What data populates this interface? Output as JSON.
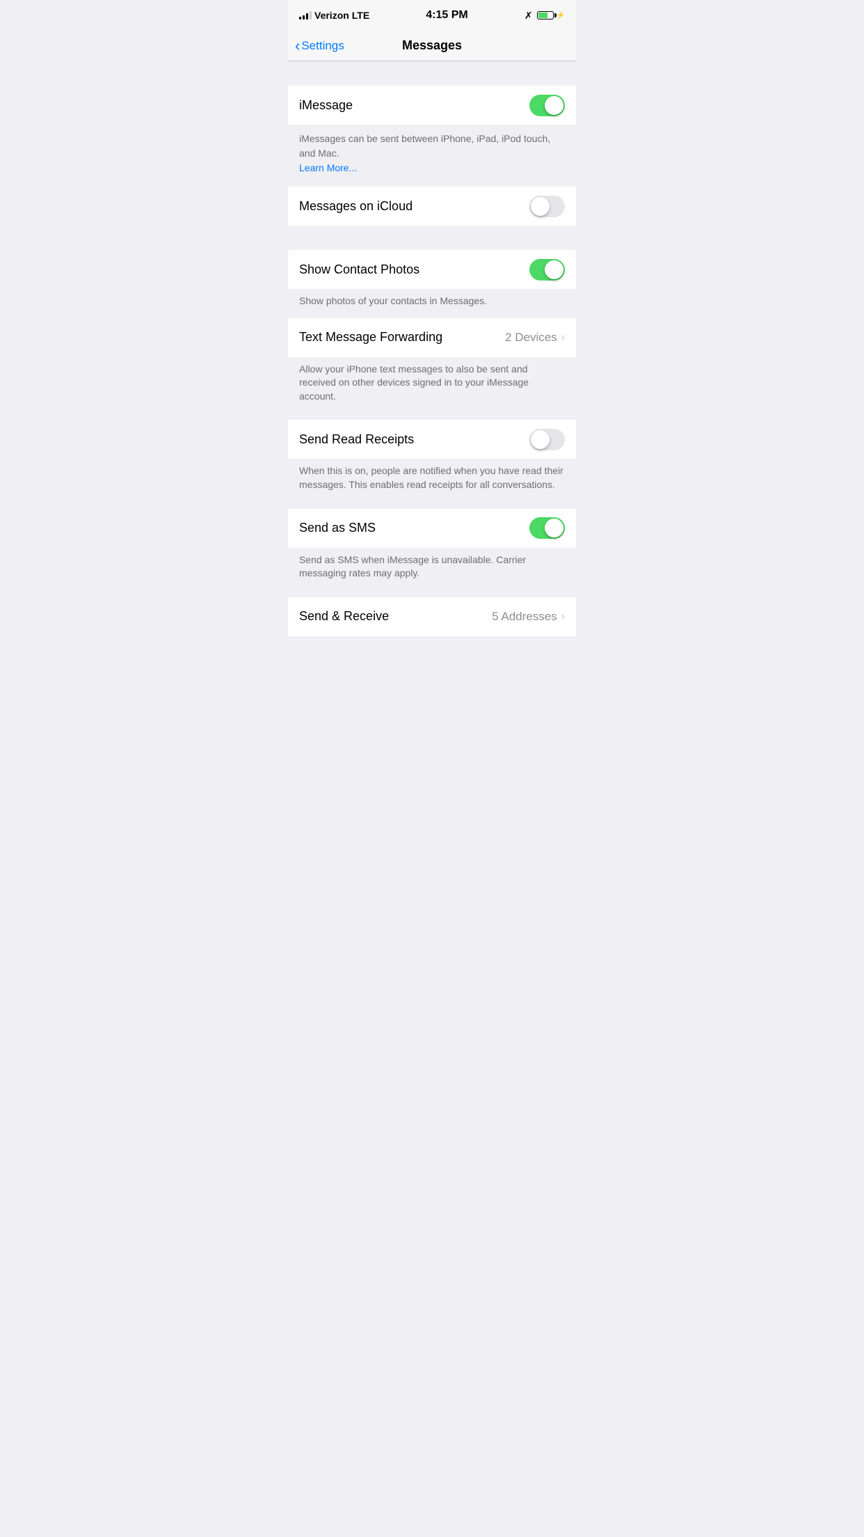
{
  "statusBar": {
    "carrier": "Verizon",
    "networkType": "LTE",
    "time": "4:15 PM"
  },
  "navBar": {
    "backLabel": "Settings",
    "title": "Messages"
  },
  "settings": {
    "iMessage": {
      "label": "iMessage",
      "state": "on",
      "description": "iMessages can be sent between iPhone, iPad, iPod touch, and Mac.",
      "learnMore": "Learn More..."
    },
    "messagesOnICloud": {
      "label": "Messages on iCloud",
      "state": "off"
    },
    "showContactPhotos": {
      "label": "Show Contact Photos",
      "state": "on",
      "description": "Show photos of your contacts in Messages."
    },
    "textMessageForwarding": {
      "label": "Text Message Forwarding",
      "value": "2 Devices",
      "description": "Allow your iPhone text messages to also be sent and received on other devices signed in to your iMessage account."
    },
    "sendReadReceipts": {
      "label": "Send Read Receipts",
      "state": "off",
      "description": "When this is on, people are notified when you have read their messages. This enables read receipts for all conversations."
    },
    "sendAsSMS": {
      "label": "Send as SMS",
      "state": "on",
      "description": "Send as SMS when iMessage is unavailable. Carrier messaging rates may apply."
    },
    "sendReceive": {
      "label": "Send & Receive",
      "value": "5 Addresses"
    }
  }
}
